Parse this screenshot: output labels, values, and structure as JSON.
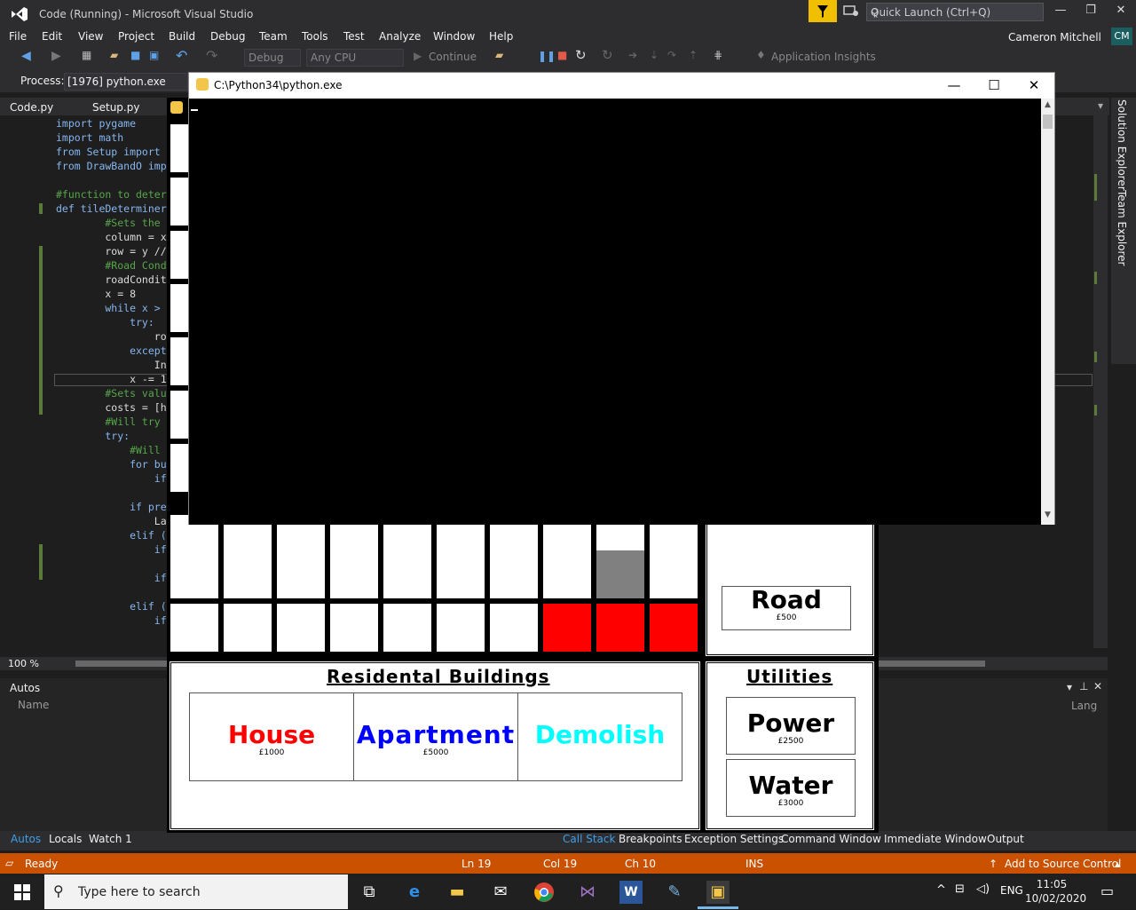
{
  "window": {
    "title": "Code (Running) - Microsoft Visual Studio"
  },
  "quick_launch": {
    "placeholder": "Quick Launch (Ctrl+Q)"
  },
  "menu": [
    "File",
    "Edit",
    "View",
    "Project",
    "Build",
    "Debug",
    "Team",
    "Tools",
    "Test",
    "Analyze",
    "Window",
    "Help"
  ],
  "user": {
    "name": "Cameron Mitchell",
    "initials": "CM"
  },
  "toolbar": {
    "config": "Debug",
    "platform": "Any CPU",
    "continue": "Continue",
    "insights": "Application Insights"
  },
  "process": {
    "label": "Process:",
    "value": "[1976] python.exe"
  },
  "tabs": [
    "Code.py",
    "Setup.py"
  ],
  "code_lines": [
    "import pygame",
    "import math",
    "from Setup import",
    "from DrawBandO imp",
    "",
    "#function to deter",
    "def tileDeterminer",
    "        #Sets the",
    "        column = x",
    "        row = y //",
    "        #Road Cond",
    "        roadCondit",
    "        x = 8",
    "        while x >",
    "            try:",
    "                ro",
    "            except",
    "                In",
    "            x -= 1",
    "        #Sets valu",
    "        costs = [h",
    "        #Will try",
    "        try:",
    "            #Will",
    "            for bu",
    "                if",
    "",
    "            if pre",
    "                La",
    "            elif (",
    "                if",
    "",
    "                if",
    "",
    "            elif (",
    "                if"
  ],
  "zoom": "100 %",
  "autos": {
    "title": "Autos",
    "name_header": "Name",
    "lang_header": "Lang"
  },
  "bottom_tabs_left": [
    "Autos",
    "Locals",
    "Watch 1"
  ],
  "bottom_tabs_right": [
    "Call Stack",
    "Breakpoints",
    "Exception Settings",
    "Command Window",
    "Immediate Window",
    "Output"
  ],
  "status": {
    "ready": "Ready",
    "ln": "Ln 19",
    "col": "Col 19",
    "ch": "Ch 10",
    "ins": "INS",
    "source": "Add to Source Control"
  },
  "side_panels": [
    "Solution Explorer",
    "Team Explorer"
  ],
  "console_window": {
    "title": "C:\\Python34\\python.exe"
  },
  "taskbar": {
    "search_placeholder": "Type here to search",
    "lang": "ENG",
    "time": "11:05",
    "date": "10/02/2020"
  },
  "game": {
    "residential_title": "Residental Buildings",
    "utilities_title": "Utilities",
    "buttons": {
      "house": {
        "label": "House",
        "cost": "£1000",
        "color": "#ff0000"
      },
      "apartment": {
        "label": "Apartment",
        "cost": "£5000",
        "color": "#0000ff"
      },
      "demolish": {
        "label": "Demolish",
        "cost": "",
        "color": "#00ffff"
      },
      "road": {
        "label": "Road",
        "cost": "£500"
      },
      "power": {
        "label": "Power",
        "cost": "£2500"
      },
      "water": {
        "label": "Water",
        "cost": "£3000"
      }
    },
    "tile_colors": {
      "empty": "#ffffff",
      "road": "#808080",
      "house": "#ff0000"
    }
  }
}
